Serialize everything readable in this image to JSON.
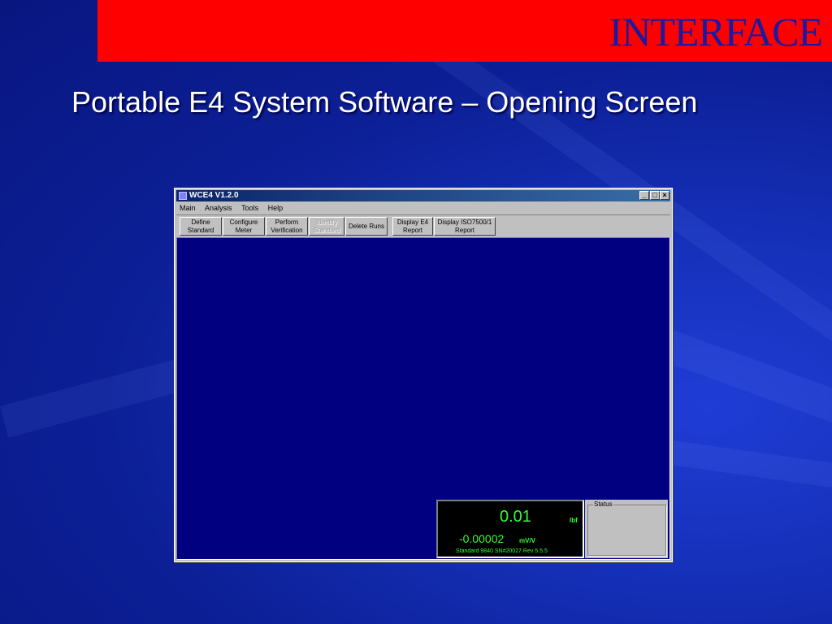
{
  "slide": {
    "header": "INTERFACE",
    "title": "Portable E4 System Software – Opening Screen"
  },
  "window": {
    "title": "WCE4 V1.2.0",
    "controls": {
      "minimize": "_",
      "maximize": "□",
      "close": "×"
    }
  },
  "menu": [
    "Main",
    "Analysis",
    "Tools",
    "Help"
  ],
  "toolbar": {
    "define_standard": "Define Standard",
    "configure_meter": "Configure Meter",
    "perform_verification": "Perform Verification",
    "identify_standard": "Identify Standard",
    "delete_runs": "Delete Runs",
    "display_e4_report": "Display E4 Report",
    "display_iso_report": "Display ISO7500/1 Report"
  },
  "meter": {
    "value": "0.01",
    "unit": "lbf",
    "signal": "-0.00002",
    "signal_unit": "mV/V",
    "info": "Standard 9840 SN#20027 Rev 5.5.5"
  },
  "status": {
    "label": "Status"
  },
  "colors": {
    "background": "#0c1f96",
    "header_bar": "#ff0000",
    "header_text": "#1a1aa0",
    "workspace": "#000080",
    "meter_text": "#33ff33"
  }
}
